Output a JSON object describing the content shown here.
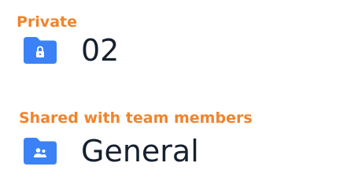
{
  "sections": [
    {
      "label": "Private",
      "folder": {
        "name": "02",
        "icon": "lock-folder-icon"
      }
    },
    {
      "label": "Shared with team members",
      "folder": {
        "name": "General",
        "icon": "team-folder-icon"
      }
    }
  ],
  "colors": {
    "section_label": "#f0842c",
    "folder_icon": "#3b82f6",
    "folder_name": "#16202e"
  }
}
